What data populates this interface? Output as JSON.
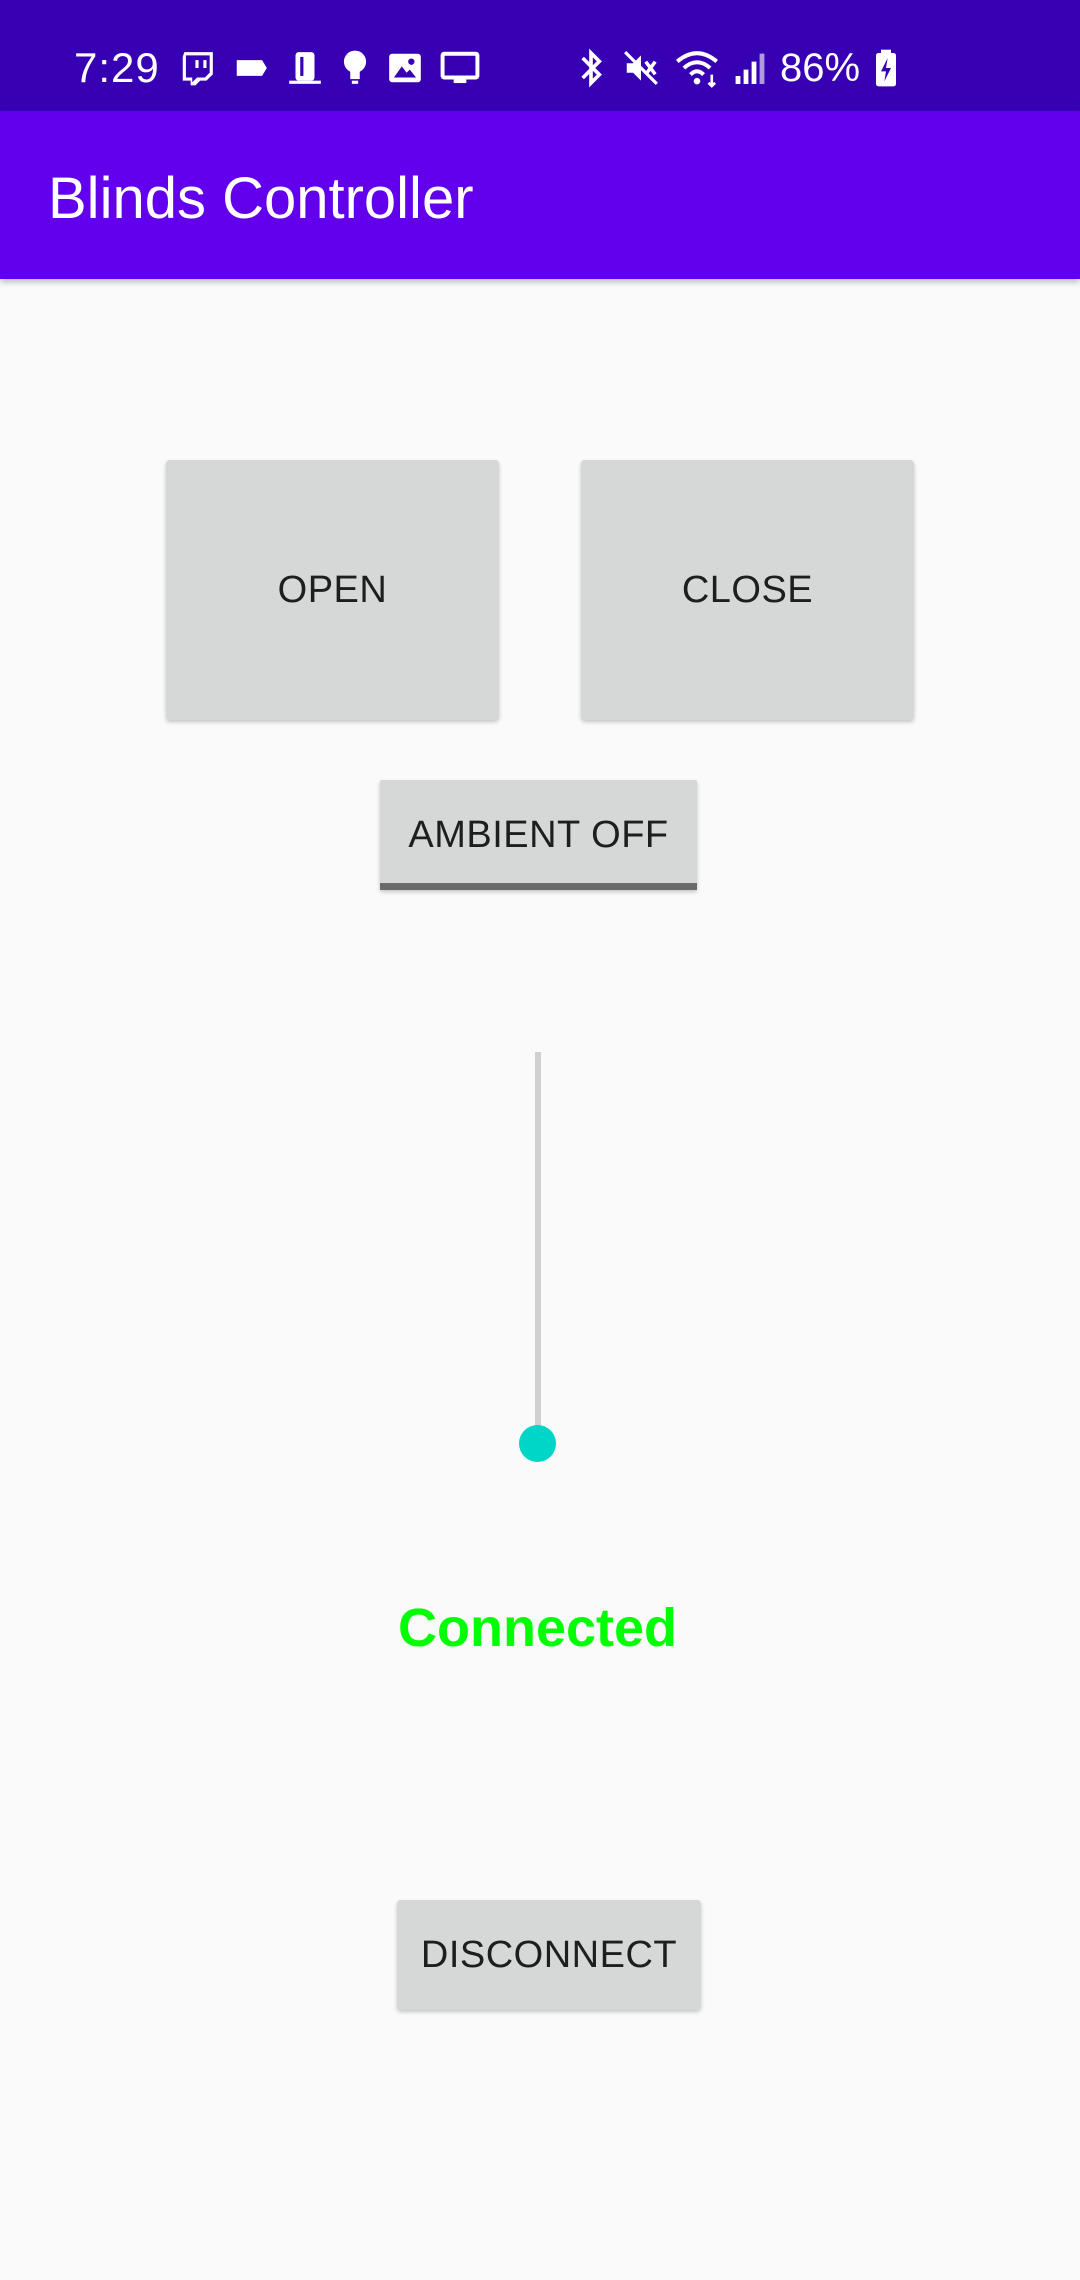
{
  "status_bar": {
    "time": "7:29",
    "battery_percent": "86%",
    "left_icons": [
      "twitch-icon",
      "tag-icon",
      "doorbell-icon",
      "bulb-icon",
      "image-icon",
      "monitor-icon"
    ],
    "right_icons": [
      "bluetooth-icon",
      "mute-icon",
      "wifi-icon",
      "signal-icon",
      "battery-charging-icon"
    ]
  },
  "app_bar": {
    "title": "Blinds Controller"
  },
  "controls": {
    "open_label": "OPEN",
    "close_label": "CLOSE",
    "ambient_label": "AMBIENT OFF",
    "disconnect_label": "DISCONNECT"
  },
  "slider": {
    "value": 0,
    "min": 0,
    "max": 100,
    "orientation": "vertical",
    "thumb_color": "#00d6c8"
  },
  "connection": {
    "status": "Connected",
    "color": "#00ff00"
  },
  "colors": {
    "status_bar": "#3700b3",
    "app_bar": "#6200ee",
    "button_bg": "#d6d7d7",
    "background": "#fafafa"
  }
}
